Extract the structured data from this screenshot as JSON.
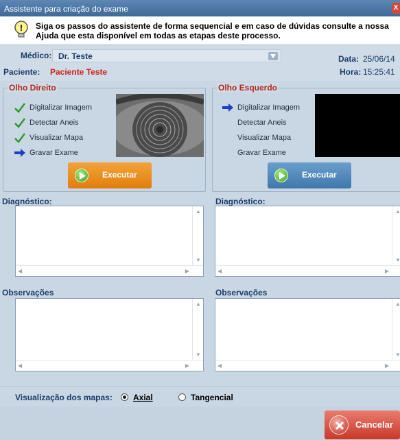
{
  "window": {
    "title": "Assistente para criação do exame",
    "close_glyph": "X"
  },
  "info": {
    "icon": "lightbulb-icon",
    "line1": "Siga os passos do assistente de forma sequencial e em caso de dúvidas consulte a nossa",
    "line2": "Ajuda que esta disponível em todas as etapas deste processo."
  },
  "header": {
    "medico_label": "Médico:",
    "medico_value": "Dr. Teste",
    "data_label": "Data:",
    "data_value": "25/06/14",
    "paciente_label": "Paciente:",
    "paciente_value": "Paciente Teste",
    "hora_label": "Hora:",
    "hora_value": "15:25:41"
  },
  "right_eye": {
    "title": "Olho Direito",
    "steps": [
      {
        "label": "Digitalizar Imagem",
        "status": "done"
      },
      {
        "label": "Detectar Aneis",
        "status": "done"
      },
      {
        "label": "Visualizar Mapa",
        "status": "done"
      },
      {
        "label": "Gravar Exame",
        "status": "current"
      }
    ],
    "button": "Executar",
    "button_color": "#e98a17"
  },
  "left_eye": {
    "title": "Olho Esquerdo",
    "steps": [
      {
        "label": "Digitalizar Imagem",
        "status": "current"
      },
      {
        "label": "Detectar Aneis",
        "status": "pending"
      },
      {
        "label": "Visualizar Mapa",
        "status": "pending"
      },
      {
        "label": "Gravar Exame",
        "status": "pending"
      }
    ],
    "button": "Executar",
    "button_color": "#4f87b8"
  },
  "sections": {
    "diagnostico": "Diagnóstico:",
    "observacoes": "Observações"
  },
  "view_mode": {
    "label": "Visualização dos mapas:",
    "options": [
      {
        "label": "Axial",
        "selected": true
      },
      {
        "label": "Tangencial",
        "selected": false
      }
    ]
  },
  "footer": {
    "cancel_label": "Cancelar"
  },
  "colors": {
    "done_check": "#2e9a2a",
    "current_arrow": "#1a3fc4",
    "group_title": "#b3271b",
    "patient_name": "#d0201a"
  }
}
